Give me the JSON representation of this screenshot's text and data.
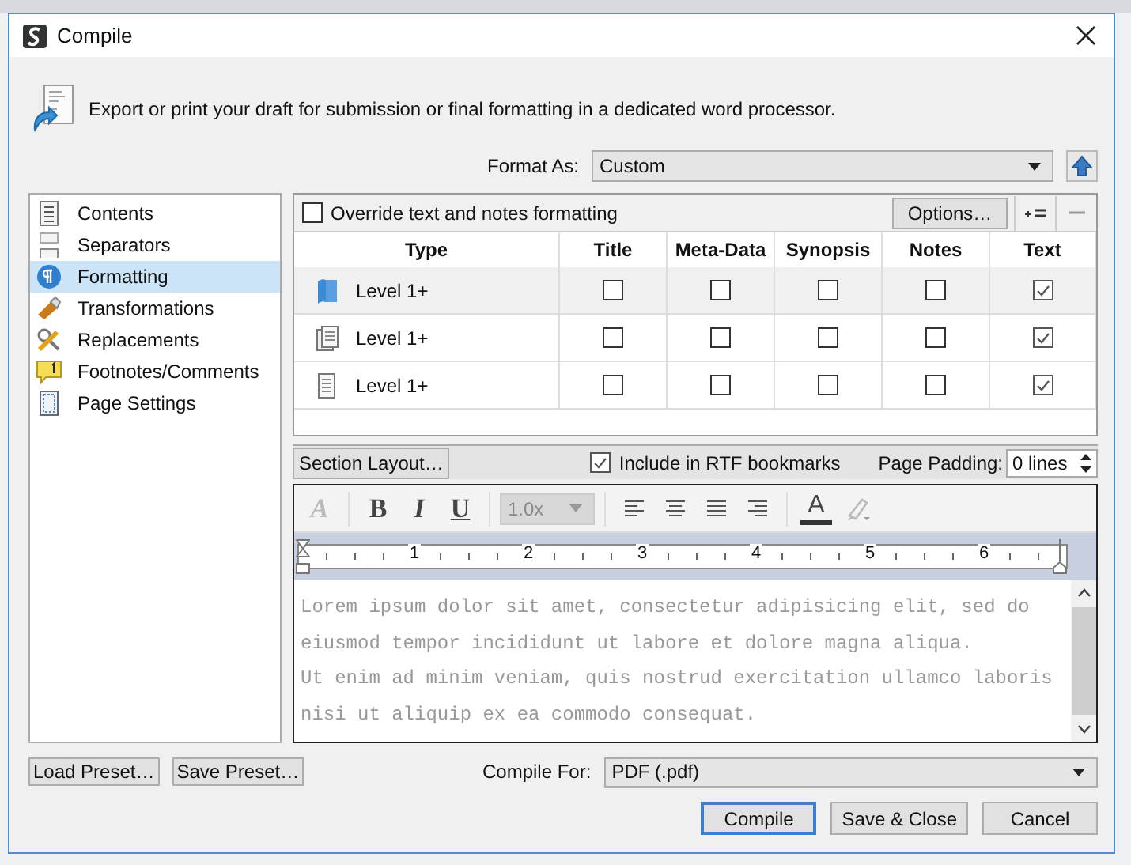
{
  "window": {
    "title": "Compile"
  },
  "description": "Export or print your draft for submission or final formatting in a dedicated word processor.",
  "format_as": {
    "label": "Format As:",
    "value": "Custom"
  },
  "sidebar": {
    "items": [
      {
        "kind": "contents",
        "label": "Contents",
        "selected": false
      },
      {
        "kind": "separators",
        "label": "Separators",
        "selected": false
      },
      {
        "kind": "formatting",
        "label": "Formatting",
        "selected": true
      },
      {
        "kind": "transformations",
        "label": "Transformations",
        "selected": false
      },
      {
        "kind": "replacements",
        "label": "Replacements",
        "selected": false
      },
      {
        "kind": "footnotes",
        "label": "Footnotes/Comments",
        "selected": false
      },
      {
        "kind": "page",
        "label": "Page Settings",
        "selected": false
      }
    ]
  },
  "override": {
    "label": "Override text and notes formatting",
    "checked": false
  },
  "options_button": "Options…",
  "table": {
    "columns": [
      "Type",
      "Title",
      "Meta-Data",
      "Synopsis",
      "Notes",
      "Text"
    ],
    "rows": [
      {
        "kind": "folder",
        "label": "Level 1+",
        "selected": true,
        "checks": [
          {
            "checked": false
          },
          {
            "checked": false
          },
          {
            "checked": false
          },
          {
            "checked": false
          },
          {
            "checked": true
          }
        ]
      },
      {
        "kind": "file-group",
        "label": "Level 1+",
        "selected": false,
        "checks": [
          {
            "checked": false
          },
          {
            "checked": false
          },
          {
            "checked": false
          },
          {
            "checked": false
          },
          {
            "checked": true
          }
        ]
      },
      {
        "kind": "file",
        "label": "Level 1+",
        "selected": false,
        "checks": [
          {
            "checked": false
          },
          {
            "checked": false
          },
          {
            "checked": false
          },
          {
            "checked": false
          },
          {
            "checked": true
          }
        ]
      }
    ]
  },
  "section_layout": "Section Layout…",
  "rtf": {
    "label": "Include in RTF bookmarks",
    "checked": true
  },
  "page_padding": {
    "label": "Page Padding:",
    "value": "0 lines"
  },
  "editor": {
    "tools": [
      {
        "kind": "style",
        "glyph": "A",
        "disabled": true
      },
      {
        "kind": "bold",
        "glyph": "B",
        "disabled": false
      },
      {
        "kind": "italic",
        "glyph": "I",
        "disabled": false
      },
      {
        "kind": "underline",
        "glyph": "U",
        "disabled": false
      }
    ],
    "line_spacing": {
      "value": "1.0x",
      "disabled": true
    },
    "color_glyph": "A",
    "ruler": [
      "1",
      "2",
      "3",
      "4",
      "5",
      "6"
    ],
    "lines": [
      "Lorem ipsum dolor sit amet, consectetur adipisicing elit, sed do",
      "eiusmod tempor incididunt ut labore et dolore magna aliqua.",
      "Ut enim ad minim veniam, quis nostrud exercitation ullamco laboris",
      "nisi ut aliquip ex ea commodo consequat."
    ]
  },
  "presets": [
    "Load Preset…",
    "Save Preset…"
  ],
  "compile_for": {
    "label": "Compile For:",
    "value": "PDF (.pdf)"
  },
  "buttons": [
    {
      "label": "Compile",
      "default": true
    },
    {
      "label": "Save & Close",
      "default": false
    },
    {
      "label": "Cancel",
      "default": false
    }
  ]
}
